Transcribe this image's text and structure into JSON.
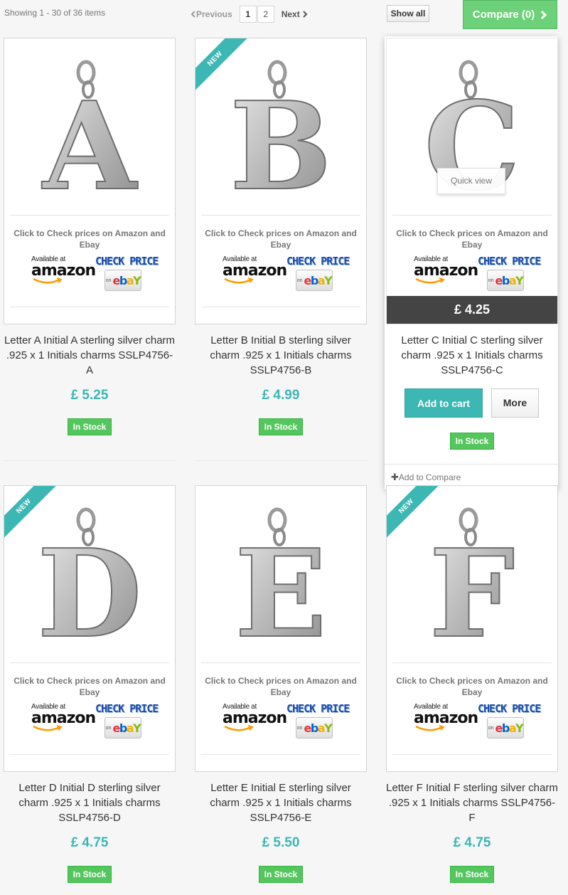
{
  "toolbar": {
    "showing": "Showing 1 - 30 of 36 items",
    "prev": "Previous",
    "pages": [
      "1",
      "2"
    ],
    "next": "Next",
    "show_all": "Show all",
    "compare": "Compare (0)"
  },
  "labels": {
    "check_text": "Click to Check prices on Amazon and Ebay",
    "available_at": "Available at",
    "amazon": "amazon",
    "check_price": "CHECK PRICE",
    "on": "on",
    "ebay": [
      "e",
      "b",
      "a",
      "Y"
    ],
    "new": "NEW",
    "in_stock": "In Stock",
    "quick_view": "Quick view",
    "add_to_cart": "Add to cart",
    "more": "More",
    "add_to_compare": "Add to Compare"
  },
  "products": [
    {
      "letter": "A",
      "name": "Letter A Initial A sterling silver charm .925 x 1 Initials charms SSLP4756-A",
      "price": "£ 5.25",
      "new": false
    },
    {
      "letter": "B",
      "name": "Letter B Initial B sterling silver charm .925 x 1 Initials charms SSLP4756-B",
      "price": "£ 4.99",
      "new": true
    },
    {
      "letter": "C",
      "name": "Letter C Initial C sterling silver charm .925 x 1 Initials charms SSLP4756-C",
      "price": "£ 4.25",
      "new": false
    },
    {
      "letter": "D",
      "name": "Letter D Initial D sterling silver charm .925 x 1 Initials charms SSLP4756-D",
      "price": "£ 4.75",
      "new": true
    },
    {
      "letter": "E",
      "name": "Letter E Initial E sterling silver charm .925 x 1 Initials charms SSLP4756-E",
      "price": "£ 5.50",
      "new": false
    },
    {
      "letter": "F",
      "name": "Letter F Initial F sterling silver charm .925 x 1 Initials charms SSLP4756-F",
      "price": "£ 4.75",
      "new": true
    }
  ],
  "colors": {
    "accent": "#3cb7b4",
    "in_stock": "#55c65e",
    "compare": "#6dd17a",
    "price_bar": "#444444"
  }
}
